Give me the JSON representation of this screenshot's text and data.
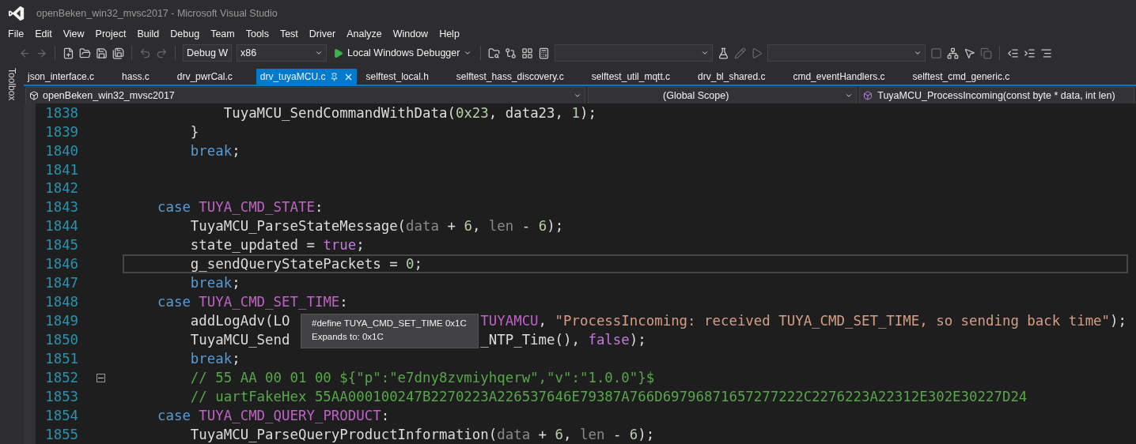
{
  "window": {
    "title": "openBeken_win32_mvsc2017 - Microsoft Visual Studio"
  },
  "menu": [
    "File",
    "Edit",
    "View",
    "Project",
    "Build",
    "Debug",
    "Team",
    "Tools",
    "Test",
    "Driver",
    "Analyze",
    "Window",
    "Help"
  ],
  "toolbar": {
    "configuration": "Debug W",
    "platform": "x86",
    "run_button": "Local Windows Debugger"
  },
  "side_tab": "Toolbox",
  "tabs": [
    {
      "label": "json_interface.c",
      "selected": false
    },
    {
      "label": "hass.c",
      "selected": false
    },
    {
      "label": "drv_pwrCal.c",
      "selected": false
    },
    {
      "label": "drv_tuyaMCU.c",
      "selected": true
    },
    {
      "label": "selftest_local.h",
      "selected": false
    },
    {
      "label": "selftest_hass_discovery.c",
      "selected": false
    },
    {
      "label": "selftest_util_mqtt.c",
      "selected": false
    },
    {
      "label": "drv_bl_shared.c",
      "selected": false
    },
    {
      "label": "cmd_eventHandlers.c",
      "selected": false
    },
    {
      "label": "selftest_cmd_generic.c",
      "selected": false
    }
  ],
  "navigation": {
    "project": "openBeken_win32_mvsc2017",
    "scope": "(Global Scope)",
    "member": "TuyaMCU_ProcessIncoming(const byte * data, int len)"
  },
  "lines": [
    {
      "number": "1838",
      "current": false,
      "fold": false,
      "segments": [
        [
          {
            "kind": "text",
            "text": "            TuyaMCU_SendCommandWithData("
          },
          {
            "kind": "num",
            "text": "0x23"
          },
          {
            "kind": "text",
            "text": ", data23, "
          },
          {
            "kind": "num",
            "text": "1"
          },
          {
            "kind": "text",
            "text": ");"
          }
        ]
      ]
    },
    {
      "number": "1839",
      "current": false,
      "fold": false,
      "segments": [
        [
          {
            "kind": "text",
            "text": "        }"
          }
        ]
      ]
    },
    {
      "number": "1840",
      "current": false,
      "fold": false,
      "segments": [
        [
          {
            "kind": "kw",
            "text": "        break"
          },
          {
            "kind": "text",
            "text": ";"
          }
        ]
      ]
    },
    {
      "number": "1841",
      "current": false,
      "fold": false
    },
    {
      "number": "1842",
      "current": false,
      "fold": false
    },
    {
      "number": "1843",
      "current": false,
      "fold": false,
      "segments": [
        [
          {
            "kind": "kw",
            "text": "    case"
          },
          {
            "kind": "macro",
            "text": " TUYA_CMD_STATE"
          },
          {
            "kind": "text",
            "text": ":"
          }
        ]
      ]
    },
    {
      "number": "1844",
      "current": false,
      "fold": false,
      "segments": [
        [
          {
            "kind": "text",
            "text": "        TuyaMCU_ParseStateMessage("
          },
          {
            "kind": "param",
            "text": "data"
          },
          {
            "kind": "text",
            "text": " + "
          },
          {
            "kind": "num",
            "text": "6"
          },
          {
            "kind": "text",
            "text": ", "
          },
          {
            "kind": "param",
            "text": "len"
          },
          {
            "kind": "text",
            "text": " - "
          },
          {
            "kind": "num",
            "text": "6"
          },
          {
            "kind": "text",
            "text": ");"
          }
        ]
      ]
    },
    {
      "number": "1845",
      "current": false,
      "fold": false,
      "segments": [
        [
          {
            "kind": "text",
            "text": "        state_updated = "
          },
          {
            "kind": "lit",
            "text": "true"
          },
          {
            "kind": "text",
            "text": ";"
          }
        ]
      ]
    },
    {
      "number": "1846",
      "current": true,
      "fold": false,
      "segments": [
        [
          {
            "kind": "text",
            "text": "        g_sendQueryStatePackets = "
          },
          {
            "kind": "num",
            "text": "0"
          },
          {
            "kind": "text",
            "text": ";"
          }
        ]
      ]
    },
    {
      "number": "1847",
      "current": false,
      "fold": false,
      "segments": [
        [
          {
            "kind": "kw",
            "text": "        break"
          },
          {
            "kind": "text",
            "text": ";"
          }
        ]
      ]
    },
    {
      "number": "1848",
      "current": false,
      "fold": false,
      "segments": [
        [
          {
            "kind": "kw",
            "text": "    case"
          },
          {
            "kind": "macro",
            "text": " TUYA_CMD_SET_TIME"
          },
          {
            "kind": "text",
            "text": ":"
          }
        ]
      ]
    },
    {
      "number": "1849",
      "current": false,
      "fold": false,
      "segments": [
        [
          {
            "kind": "text",
            "text": "        addLogAdv(LO"
          }
        ],
        [
          {
            "kind": "macro",
            "text": "TUYAMCU"
          },
          {
            "kind": "text",
            "text": ", "
          },
          {
            "kind": "str",
            "text": "\"ProcessIncoming: received TUYA_CMD_SET_TIME, so sending back time\""
          },
          {
            "kind": "text",
            "text": ");"
          }
        ]
      ]
    },
    {
      "number": "1850",
      "current": false,
      "fold": false,
      "segments": [
        [
          {
            "kind": "text",
            "text": "        TuyaMCU_Send"
          }
        ],
        [
          {
            "kind": "text",
            "text": "_NTP_Time(), "
          },
          {
            "kind": "lit",
            "text": "false"
          },
          {
            "kind": "text",
            "text": ");"
          }
        ]
      ]
    },
    {
      "number": "1851",
      "current": false,
      "fold": false,
      "segments": [
        [
          {
            "kind": "kw",
            "text": "        break"
          },
          {
            "kind": "text",
            "text": ";"
          }
        ]
      ]
    },
    {
      "number": "1852",
      "current": false,
      "fold": true,
      "segments": [
        [
          {
            "kind": "cmt",
            "text": "        // 55 AA 00 01 00 ${\"p\":\"e7dny8zvmiyhqerw\",\"v\":\"1.0.0\"}$"
          }
        ]
      ]
    },
    {
      "number": "1853",
      "current": false,
      "fold": false,
      "segments": [
        [
          {
            "kind": "cmt",
            "text": "        // uartFakeHex 55AA000100247B2270223A226537646E79387A766D69796871657277222C2276223A22312E302E30227D24"
          }
        ]
      ]
    },
    {
      "number": "1854",
      "current": false,
      "fold": false,
      "segments": [
        [
          {
            "kind": "kw",
            "text": "    case"
          },
          {
            "kind": "macro",
            "text": " TUYA_CMD_QUERY_PRODUCT"
          },
          {
            "kind": "text",
            "text": ":"
          }
        ]
      ]
    },
    {
      "number": "1855",
      "current": false,
      "fold": false,
      "segments": [
        [
          {
            "kind": "text",
            "text": "        TuyaMCU_ParseQueryProductInformation("
          },
          {
            "kind": "param",
            "text": "data"
          },
          {
            "kind": "text",
            "text": " + "
          },
          {
            "kind": "num",
            "text": "6"
          },
          {
            "kind": "text",
            "text": ", "
          },
          {
            "kind": "param",
            "text": "len"
          },
          {
            "kind": "text",
            "text": " - "
          },
          {
            "kind": "num",
            "text": "6"
          },
          {
            "kind": "text",
            "text": ");"
          }
        ]
      ]
    }
  ],
  "tooltip": [
    "#define TUYA_CMD_SET_TIME 0x1C",
    "Expands to: 0x1C"
  ]
}
